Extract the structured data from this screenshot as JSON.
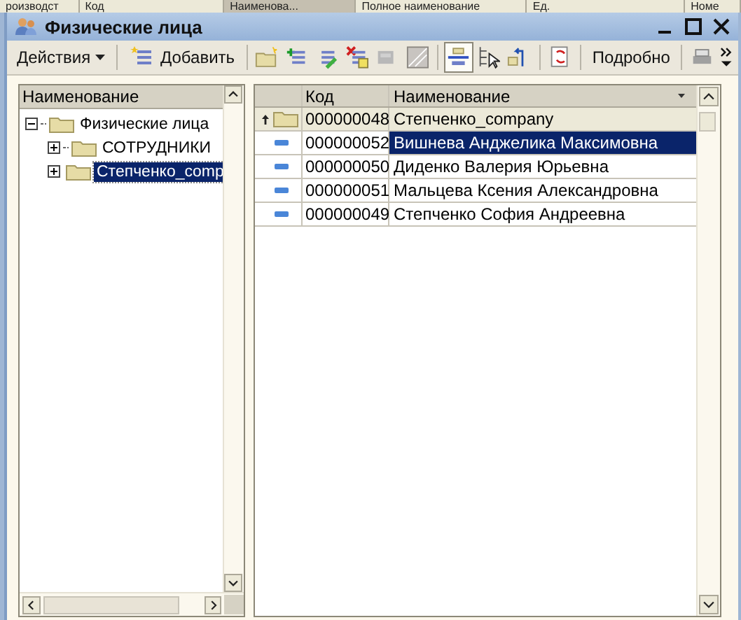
{
  "background_header": [
    "роизводст",
    "Код",
    "Наименова...",
    "Полное наименование",
    "Ед.",
    "Номе"
  ],
  "window": {
    "title": "Физические лица"
  },
  "toolbar": {
    "actions_menu": "Действия",
    "add_button": "Добавить",
    "details_button": "Подробно"
  },
  "tree": {
    "column": "Наименование",
    "items": [
      {
        "label": "Физические лица",
        "expanded": true,
        "selected": false,
        "children": [
          {
            "label": "СОТРУДНИКИ",
            "expanded": false,
            "selected": false
          },
          {
            "label": "Степченко_comp",
            "expanded": false,
            "selected": true
          }
        ]
      }
    ]
  },
  "table": {
    "columns": [
      "Код",
      "Наименование"
    ],
    "rows": [
      {
        "kind": "group",
        "code": "000000048",
        "name": "Степченко_company",
        "selected": false
      },
      {
        "kind": "item",
        "code": "000000052",
        "name": "Вишнева Анджелика Максимовна",
        "selected": true
      },
      {
        "kind": "item",
        "code": "000000050",
        "name": "Диденко Валерия Юрьевна",
        "selected": false
      },
      {
        "kind": "item",
        "code": "000000051",
        "name": "Мальцева Ксения Александровна",
        "selected": false
      },
      {
        "kind": "item",
        "code": "000000049",
        "name": "Степченко София Андреевна",
        "selected": false
      }
    ]
  }
}
